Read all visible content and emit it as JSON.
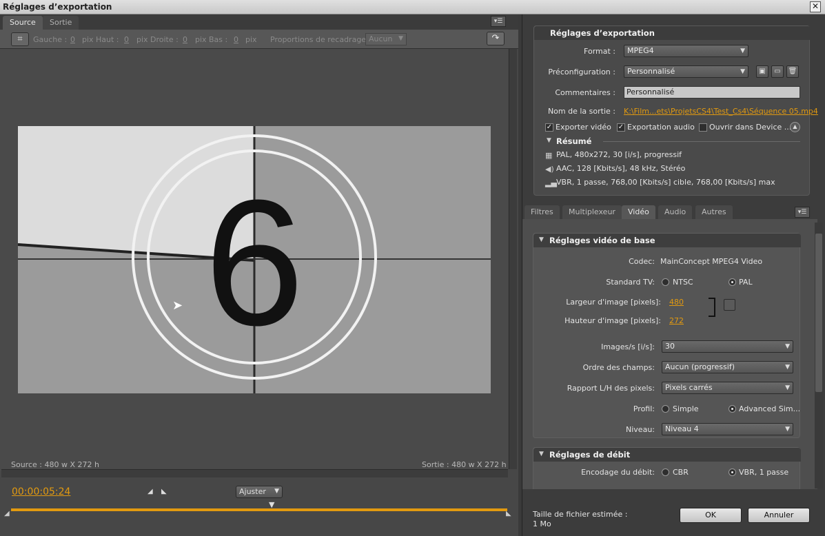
{
  "window": {
    "title": "Réglages d’exportation",
    "close_glyph": "✕"
  },
  "left": {
    "tabs": [
      "Source",
      "Sortie"
    ],
    "crop": {
      "gauche": "Gauche :",
      "haut": "Haut :",
      "droite": "Droite :",
      "bas": "Bas :",
      "value": "0",
      "unit": "pix",
      "ratio_label": "Proportions de recadrage :",
      "ratio_value": "Aucun"
    },
    "source_info": "Source : 480 w X 272 h",
    "output_info": "Sortie : 480 w X 272 h",
    "countdown": "6",
    "timecode": "00:00:05:24",
    "fit_select": "Ajuster"
  },
  "export": {
    "header": "Réglages d’exportation",
    "format_label": "Format :",
    "format_value": "MPEG4",
    "preset_label": "Préconfiguration :",
    "preset_value": "Personnalisé",
    "comments_label": "Commentaires :",
    "comments_value": "Personnalisé",
    "output_label": "Nom de la sortie :",
    "output_value": "K:\\Film...ets\\ProjetsCS4\\Test_Cs4\\Séquence 05.mp4",
    "export_video": "Exporter vidéo",
    "export_audio": "Exportation audio",
    "open_device": "Ouvrir dans Device ...",
    "summary_header": "Résumé",
    "summary": [
      "PAL, 480x272, 30 [i/s], progressif",
      "AAC, 128 [Kbits/s], 48 kHz, Stéréo",
      "VBR, 1 passe, 768,00 [Kbits/s] cible, 768,00 [Kbits/s] max"
    ]
  },
  "tabs2": [
    "Filtres",
    "Multiplexeur",
    "Vidéo",
    "Audio",
    "Autres"
  ],
  "video": {
    "header": "Réglages vidéo de base",
    "codec_label": "Codec:",
    "codec_value": "MainConcept MPEG4 Video",
    "tv_label": "Standard TV:",
    "ntsc": "NTSC",
    "pal": "PAL",
    "width_label": "Largeur d'image [pixels]:",
    "width_value": "480",
    "height_label": "Hauteur d'image [pixels]:",
    "height_value": "272",
    "fps_label": "Images/s [i/s]:",
    "fps_value": "30",
    "field_label": "Ordre des champs:",
    "field_value": "Aucun (progressif)",
    "par_label": "Rapport L/H des pixels:",
    "par_value": "Pixels carrés",
    "profile_label": "Profil:",
    "profile_simple": "Simple",
    "profile_adv": "Advanced Sim...",
    "level_label": "Niveau:",
    "level_value": "Niveau 4"
  },
  "bitrate": {
    "header": "Réglages de débit",
    "encoding_label": "Encodage du débit:",
    "cbr": "CBR",
    "vbr": "VBR, 1 passe"
  },
  "footer": {
    "size_label": "Taille de fichier estimée :",
    "size_value": "1 Mo",
    "ok": "OK",
    "cancel": "Annuler"
  }
}
